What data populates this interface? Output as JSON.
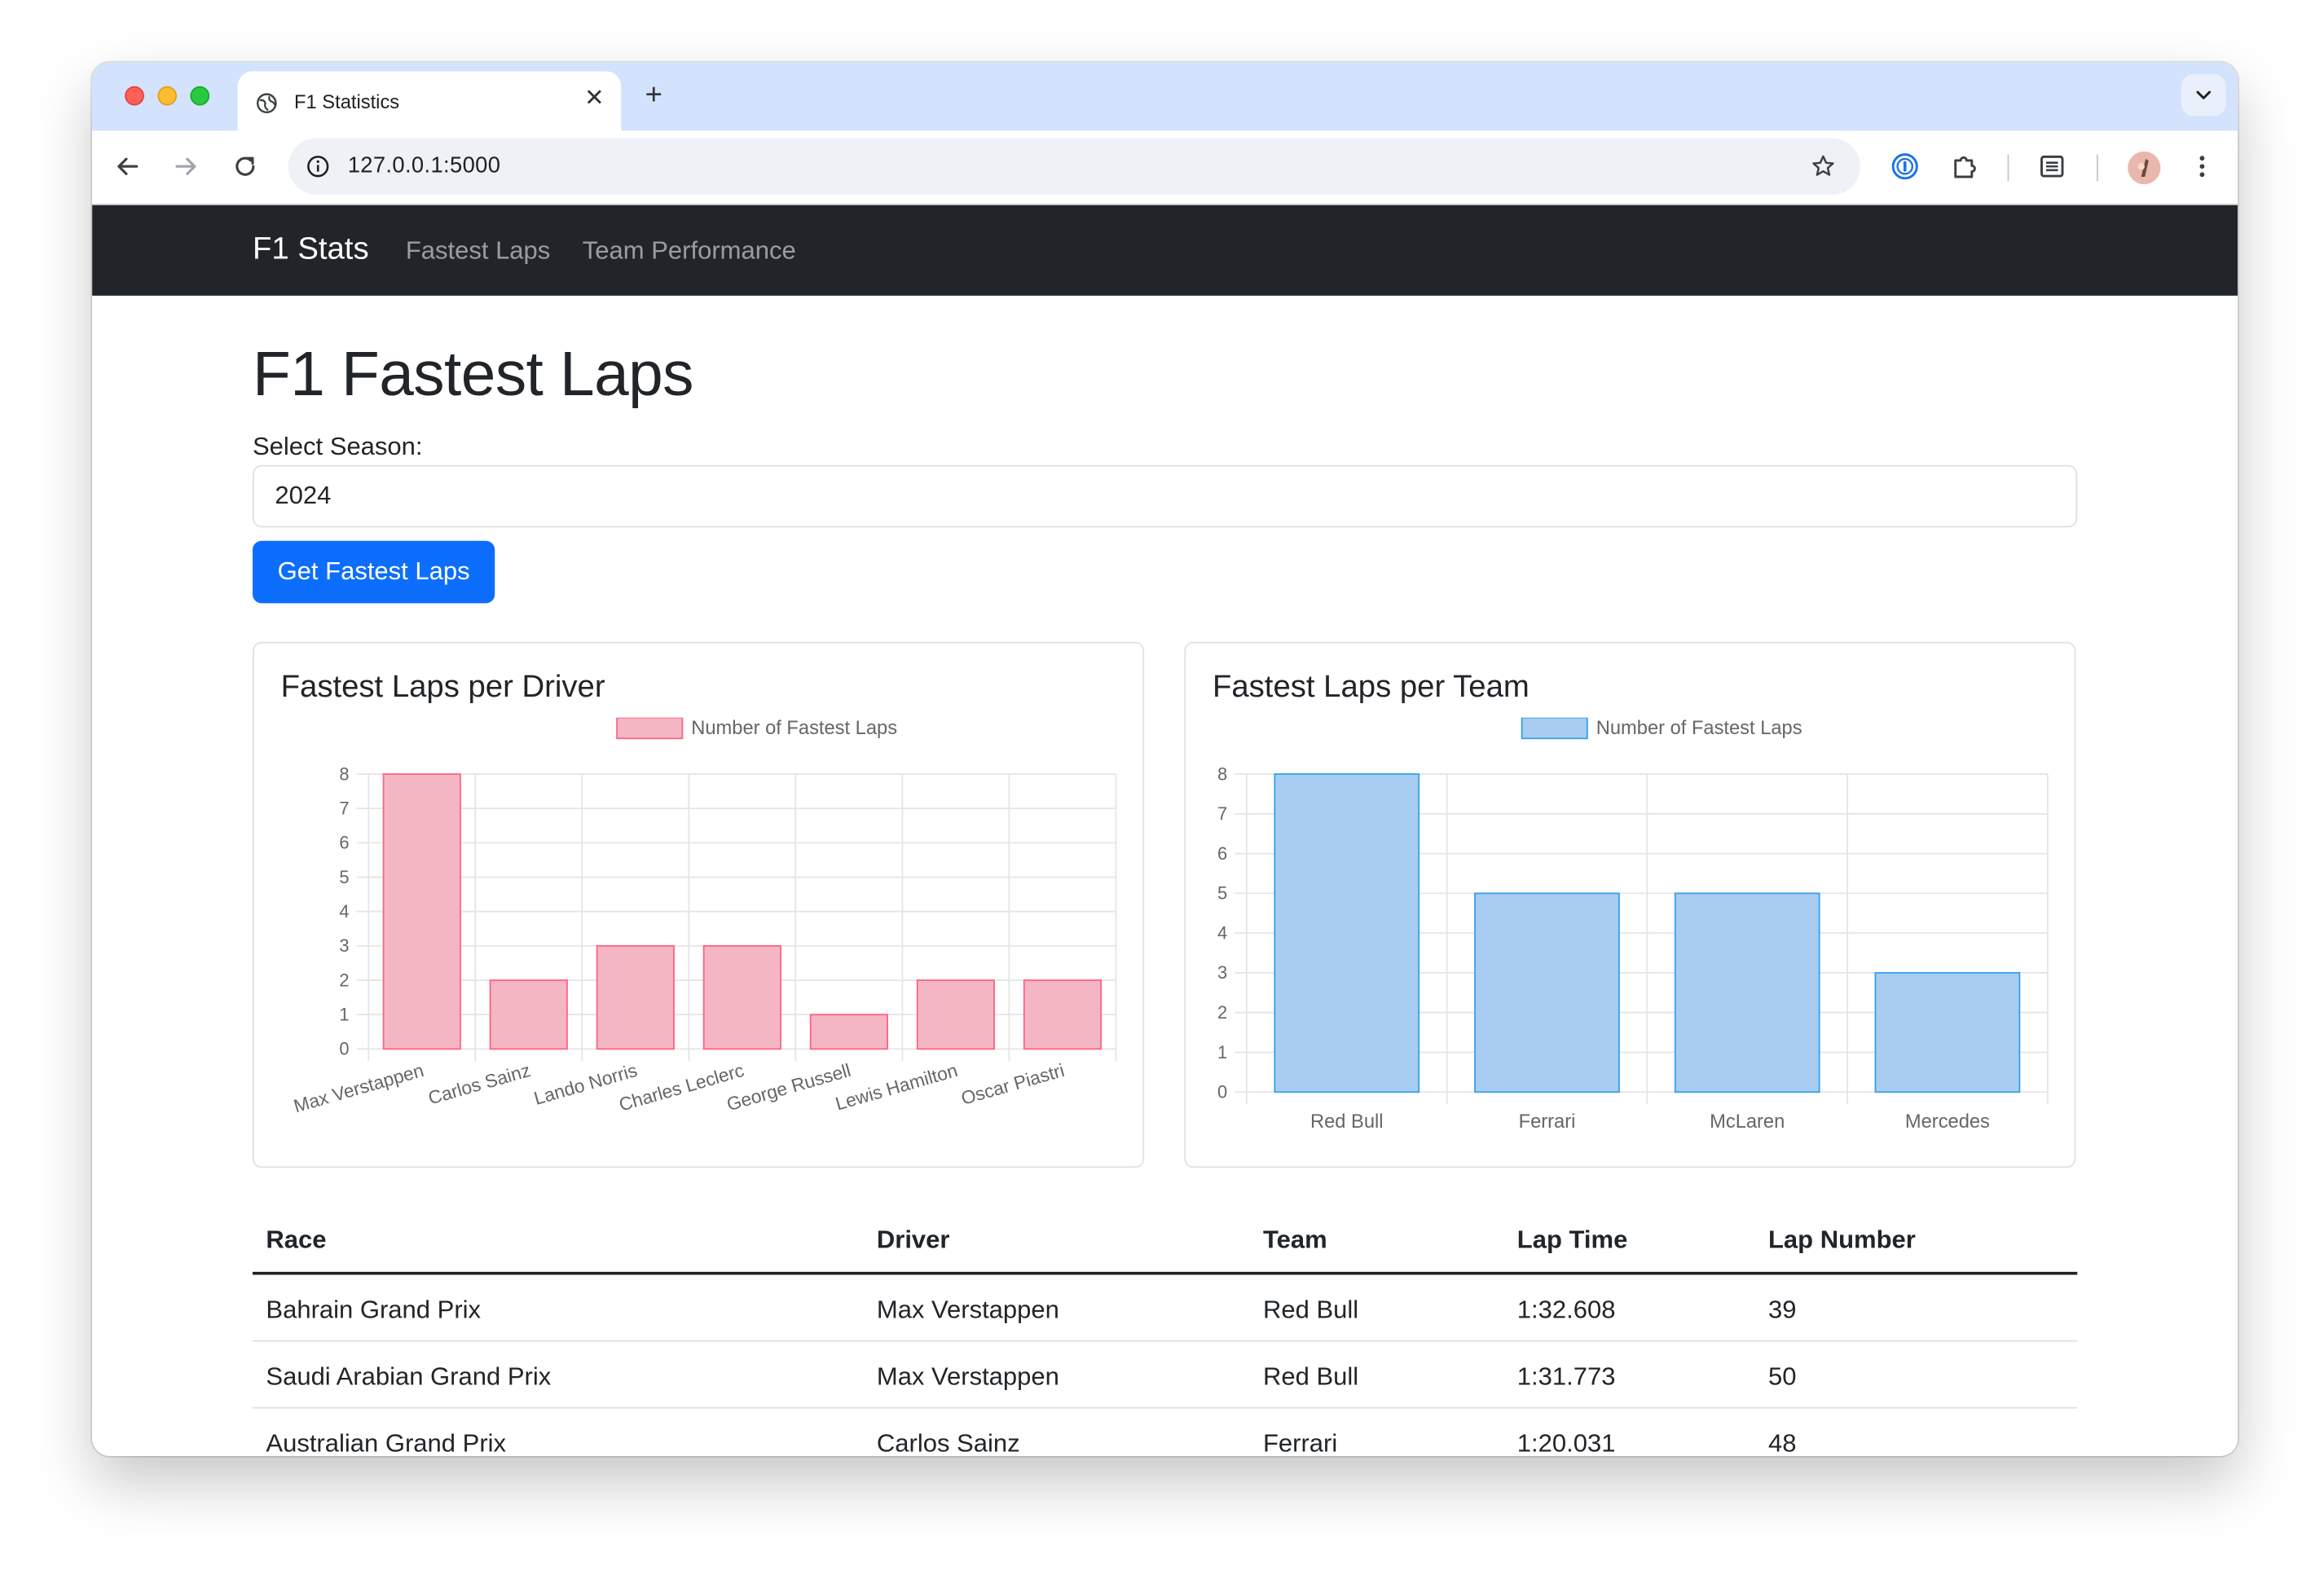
{
  "browser": {
    "tab_title": "F1 Statistics",
    "url": "127.0.0.1:5000"
  },
  "navbar": {
    "brand": "F1 Stats",
    "links": [
      "Fastest Laps",
      "Team Performance"
    ]
  },
  "main": {
    "title": "F1 Fastest Laps",
    "season_label": "Select Season:",
    "season_value": "2024",
    "submit_label": "Get Fastest Laps"
  },
  "charts": {
    "driver_title": "Fastest Laps per Driver",
    "team_title": "Fastest Laps per Team"
  },
  "chart_data": [
    {
      "type": "bar",
      "title": "Fastest Laps per Driver",
      "categories": [
        "Max Verstappen",
        "Carlos Sainz",
        "Lando Norris",
        "Charles Leclerc",
        "George Russell",
        "Lewis Hamilton",
        "Oscar Piastri"
      ],
      "series": [
        {
          "name": "Number of Fastest Laps",
          "values": [
            8,
            2,
            3,
            3,
            1,
            2,
            2
          ]
        }
      ],
      "ylim": [
        0,
        8
      ],
      "yticks": [
        0,
        1,
        2,
        3,
        4,
        5,
        6,
        7,
        8
      ],
      "grid": true,
      "legend": "top",
      "color": "#ff6384",
      "fill": "#f5b6c3"
    },
    {
      "type": "bar",
      "title": "Fastest Laps per Team",
      "categories": [
        "Red Bull",
        "Ferrari",
        "McLaren",
        "Mercedes"
      ],
      "series": [
        {
          "name": "Number of Fastest Laps",
          "values": [
            8,
            5,
            5,
            3
          ]
        }
      ],
      "ylim": [
        0,
        8
      ],
      "yticks": [
        0,
        1,
        2,
        3,
        4,
        5,
        6,
        7,
        8
      ],
      "grid": true,
      "legend": "top",
      "color": "#36a2eb",
      "fill": "#a9cdf1"
    }
  ],
  "table": {
    "headers": [
      "Race",
      "Driver",
      "Team",
      "Lap Time",
      "Lap Number"
    ],
    "rows": [
      [
        "Bahrain Grand Prix",
        "Max Verstappen",
        "Red Bull",
        "1:32.608",
        "39"
      ],
      [
        "Saudi Arabian Grand Prix",
        "Max Verstappen",
        "Red Bull",
        "1:31.773",
        "50"
      ],
      [
        "Australian Grand Prix",
        "Carlos Sainz",
        "Ferrari",
        "1:20.031",
        "48"
      ]
    ]
  }
}
